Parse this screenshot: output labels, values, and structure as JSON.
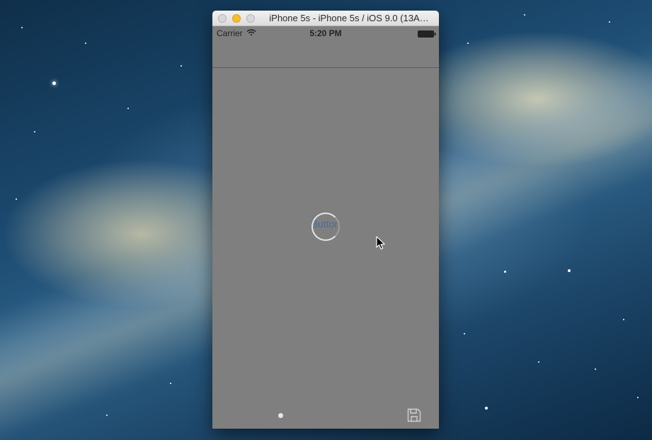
{
  "window": {
    "title": "iPhone 5s - iPhone 5s / iOS 9.0 (13A…"
  },
  "status_bar": {
    "carrier": "Carrier",
    "time": "5:20 PM",
    "icons": [
      "wifi-icon",
      "battery-icon"
    ]
  },
  "main": {
    "button_label": "Button"
  },
  "toolbar": {
    "icons": [
      "page-dot",
      "save-icon"
    ]
  },
  "colors": {
    "screen_background": "#7f7f7f",
    "button_text": "#4a6d97",
    "minimize_light": "#f6be2c"
  }
}
